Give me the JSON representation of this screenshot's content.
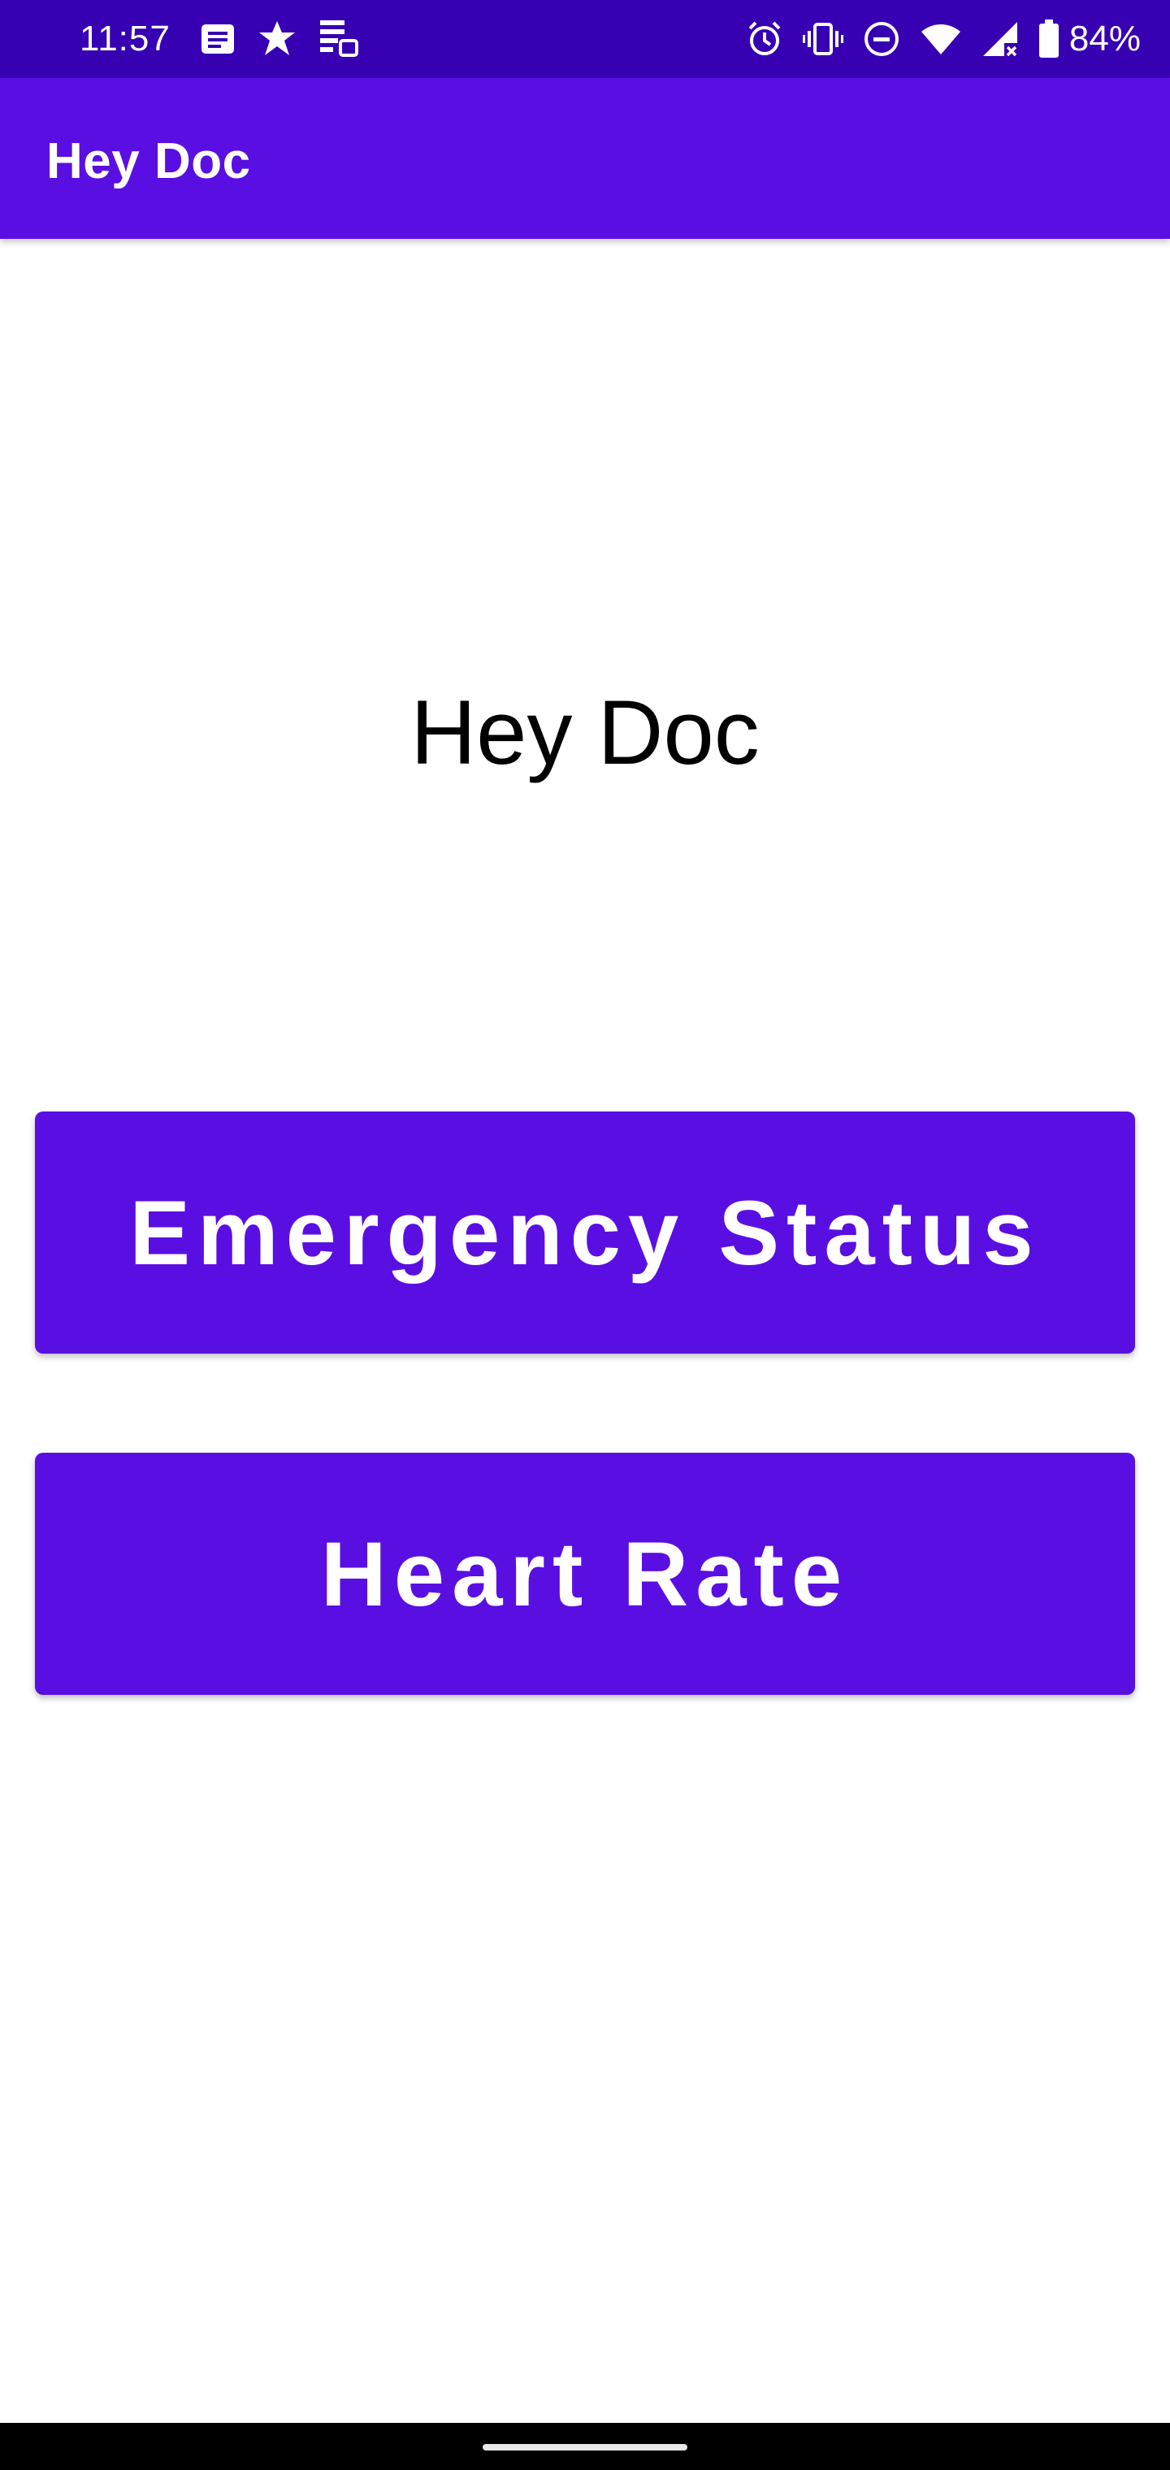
{
  "status_bar": {
    "time": "11:57",
    "battery_percent": "84%",
    "left_icons": [
      "messages-icon",
      "pinwheel-icon",
      "tasks-icon"
    ],
    "right_icons": [
      "alarm-icon",
      "vibrate-icon",
      "do-not-disturb-icon",
      "wifi-icon",
      "cellular-no-signal-icon",
      "battery-icon"
    ],
    "background_color": "#3700B3"
  },
  "app_bar": {
    "title": "Hey Doc",
    "background_color": "#5A0FE2"
  },
  "main": {
    "title": "Hey Doc",
    "buttons": {
      "emergency_label": "Emergency Status",
      "heart_rate_label": "Heart Rate"
    },
    "button_color": "#5A0FE2"
  }
}
